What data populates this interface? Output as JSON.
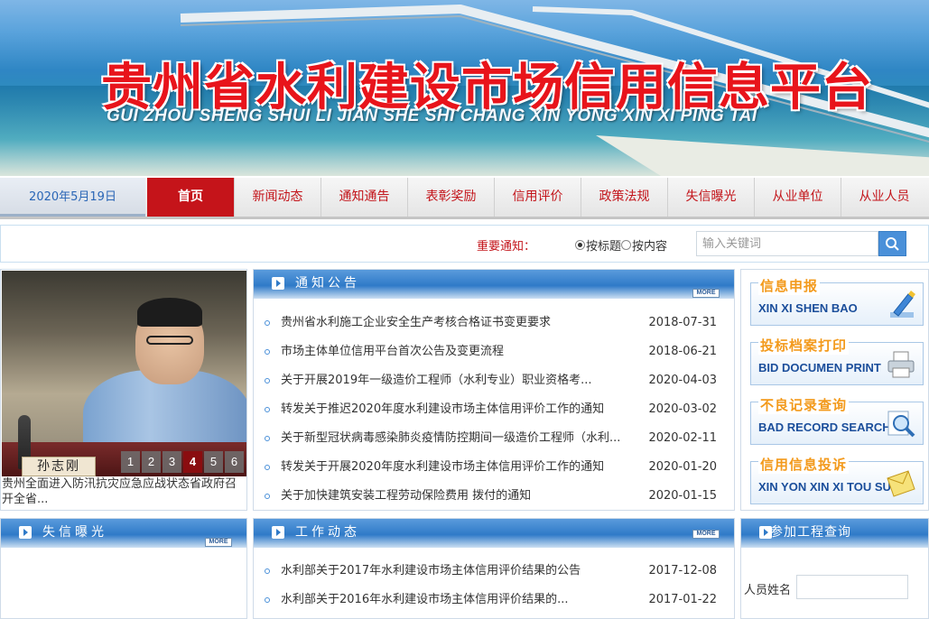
{
  "banner": {
    "title_cn": "贵州省水利建设市场信用信息平台",
    "title_pinyin": "GUI ZHOU SHENG SHUI LI JIAN SHE SHI CHANG XIN YONG XIN XI PING TAI"
  },
  "nav": {
    "date": "2020年5月19日",
    "items": [
      "首页",
      "新闻动态",
      "通知通告",
      "表彰奖励",
      "信用评价",
      "政策法规",
      "失信曝光",
      "从业单位",
      "从业人员"
    ]
  },
  "search": {
    "label": "重要通知：",
    "option_title": "按标题",
    "option_content": "按内容",
    "placeholder": "输入关键词"
  },
  "photo": {
    "nametag": "孙志刚",
    "pages": [
      "1",
      "2",
      "3",
      "4",
      "5",
      "6"
    ],
    "active_page": "4",
    "caption": "贵州全面进入防汛抗灾应急应战状态省政府召开全省..."
  },
  "notice": {
    "title": "通知公告",
    "more": "MORE",
    "items": [
      {
        "title": "贵州省水利施工企业安全生产考核合格证书变更要求",
        "date": "2018-07-31"
      },
      {
        "title": "市场主体单位信用平台首次公告及变更流程",
        "date": "2018-06-21"
      },
      {
        "title": "关于开展2019年一级造价工程师（水利专业）职业资格考...",
        "date": "2020-04-03"
      },
      {
        "title": "转发关于推迟2020年度水利建设市场主体信用评价工作的通知",
        "date": "2020-03-02"
      },
      {
        "title": "关于新型冠状病毒感染肺炎疫情防控期间一级造价工程师（水利...",
        "date": "2020-02-11"
      },
      {
        "title": "转发关于开展2020年度水利建设市场主体信用评价工作的通知",
        "date": "2020-01-20"
      },
      {
        "title": "关于加快建筑安装工程劳动保险费用 拨付的通知",
        "date": "2020-01-15"
      }
    ]
  },
  "sidebar": {
    "buttons": [
      {
        "cn": "信息申报",
        "en": "XIN XI SHEN BAO",
        "icon": "pen-icon"
      },
      {
        "cn": "投标档案打印",
        "en": "BID DOCUMEN PRINT",
        "icon": "printer-icon"
      },
      {
        "cn": "不良记录查询",
        "en": "BAD RECORD SEARCH",
        "icon": "magnifier-icon"
      },
      {
        "cn": "信用信息投诉",
        "en": "XIN YON XIN XI TOU SU",
        "icon": "envelope-icon"
      }
    ]
  },
  "shixin": {
    "title": "失信曝光",
    "more": "MORE"
  },
  "work": {
    "title": "工作动态",
    "more": "MORE",
    "items": [
      {
        "title": "水利部关于2017年水利建设市场主体信用评价结果的公告",
        "date": "2017-12-08"
      },
      {
        "title": "水利部关于2016年水利建设市场主体信用评价结果的...",
        "date": "2017-01-22"
      }
    ]
  },
  "query": {
    "title": "参加工程查询",
    "name_label": "人员姓名"
  },
  "colors": {
    "brand_red": "#c5141a",
    "accent_blue": "#2f7ac8",
    "orange": "#f39a1c"
  }
}
